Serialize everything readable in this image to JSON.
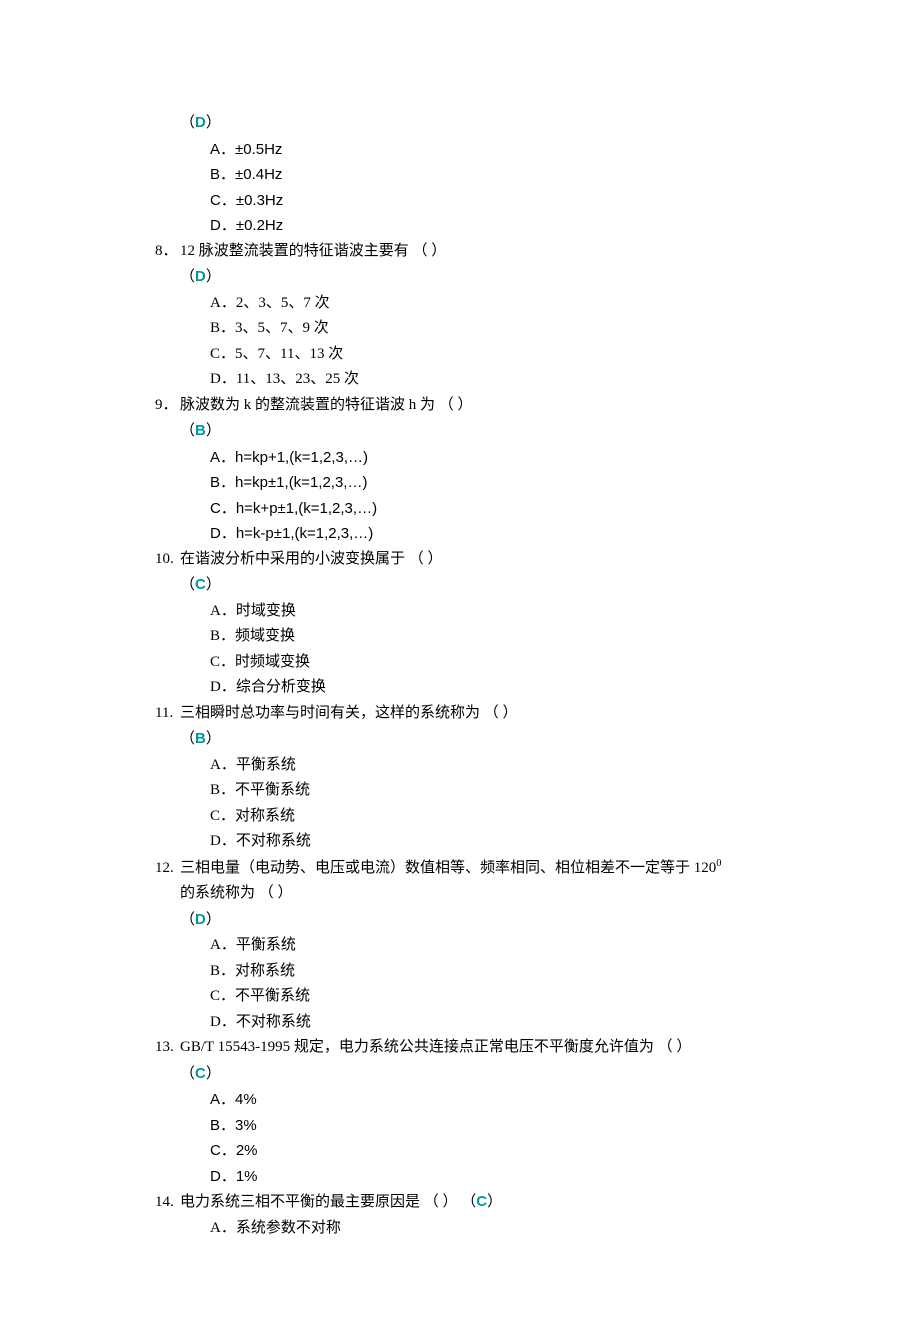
{
  "q7": {
    "answer": "D",
    "options": {
      "a": "A．±0.5Hz",
      "b": "B．±0.4Hz",
      "c": "C．±0.3Hz",
      "d": "D．±0.2Hz"
    }
  },
  "q8": {
    "num": "8．",
    "stem": "12 脉波整流装置的特征谐波主要有 （ ）",
    "answer": "D",
    "options": {
      "a": "A．2、3、5、7 次",
      "b": "B．3、5、7、9 次",
      "c": "C．5、7、11、13 次",
      "d": "D．11、13、23、25 次"
    }
  },
  "q9": {
    "num": "9．",
    "stem": "脉波数为 k 的整流装置的特征谐波 h 为 （  ）",
    "answer": "B",
    "options": {
      "a": "A．h=kp+1,(k=1,2,3,…)",
      "b": "B．h=kp±1,(k=1,2,3,…)",
      "c": "C．h=k+p±1,(k=1,2,3,…)",
      "d": "D．h=k-p±1,(k=1,2,3,…)"
    }
  },
  "q10": {
    "num": "10.",
    "stem": "在谐波分析中采用的小波变换属于 （ ）",
    "answer": "C",
    "options": {
      "a": "A．时域变换",
      "b": "B．频域变换",
      "c": "C．时频域变换",
      "d": "D．综合分析变换"
    }
  },
  "q11": {
    "num": "11.",
    "stem": "三相瞬时总功率与时间有关，这样的系统称为 （ ）",
    "answer": "B",
    "options": {
      "a": "A．平衡系统",
      "b": "B．不平衡系统",
      "c": "C．对称系统",
      "d": "D．不对称系统"
    }
  },
  "q12": {
    "num": "12.",
    "stem_line1": "三相电量（电动势、电压或电流）数值相等、频率相同、相位相差不一定等于 120",
    "stem_line1_sup": "0",
    "stem_line2": "的系统称为 （ ）",
    "answer": "D",
    "options": {
      "a": "A．平衡系统",
      "b": "B．对称系统",
      "c": "C．不平衡系统",
      "d": "D．不对称系统"
    }
  },
  "q13": {
    "num": "13.",
    "stem": "GB/T 15543-1995 规定，电力系统公共连接点正常电压不平衡度允许值为 （  ）",
    "answer": "C",
    "options": {
      "a": "A．4%",
      "b": "B．3%",
      "c": "C．2%",
      "d": "D．1%"
    }
  },
  "q14": {
    "num": "14.",
    "stem": "电力系统三相不平衡的最主要原因是 （ ）",
    "answer": "C",
    "options": {
      "a": "A．系统参数不对称"
    }
  },
  "paren_open": "（",
  "paren_close": "）"
}
